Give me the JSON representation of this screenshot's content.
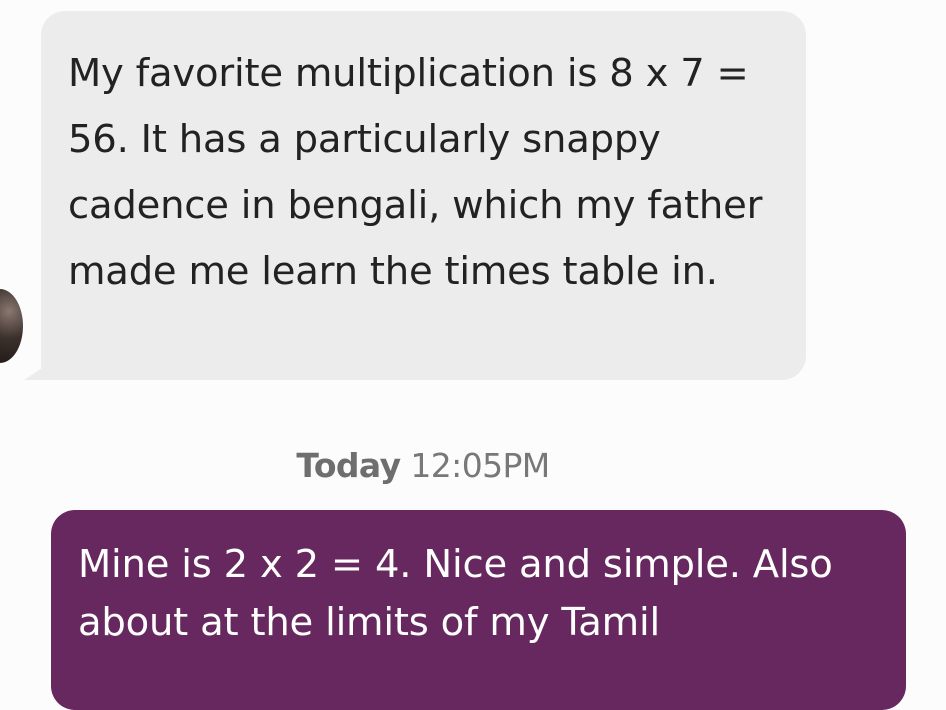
{
  "messages": {
    "incoming": {
      "text": "My favorite multiplication is 8 x 7 = 56. It has a particularly snappy cadence in bengali, which my father made me learn the times table in."
    },
    "timestamp": {
      "day": "Today",
      "time": "12:05PM"
    },
    "outgoing": {
      "text": "Mine is 2 x 2 = 4. Nice and simple. Also about at the limits of my Tamil"
    }
  },
  "colors": {
    "incoming_bubble": "#ececec",
    "outgoing_bubble": "#66285e",
    "background": "#fdfcfc",
    "timestamp_text": "#787878"
  },
  "icons": {
    "avatar": "contact-avatar"
  }
}
